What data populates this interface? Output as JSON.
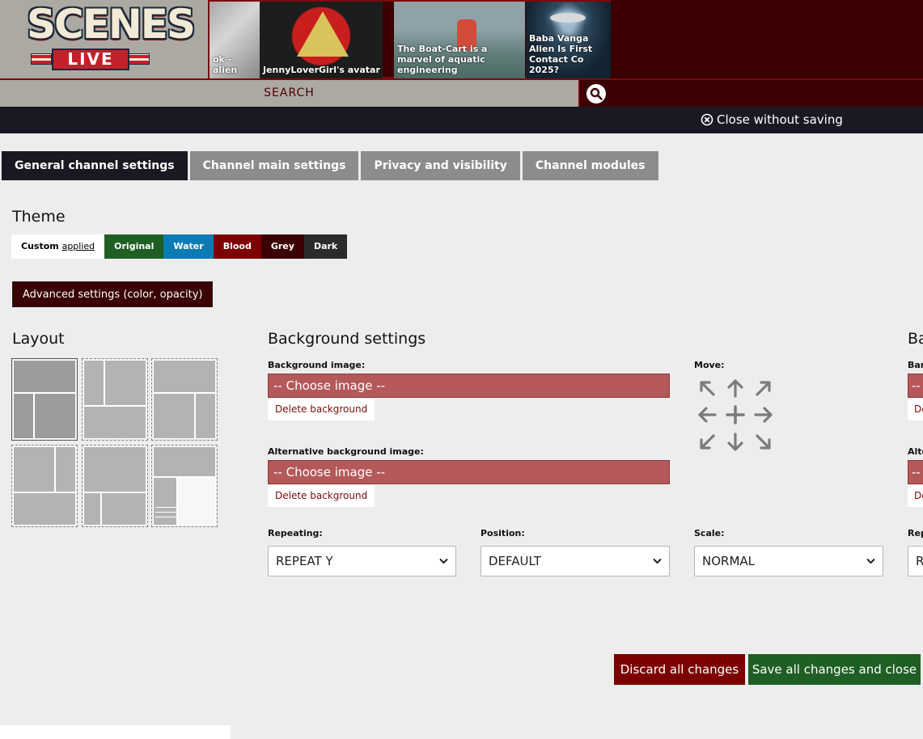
{
  "header": {
    "logo_line1": "SCENES",
    "logo_line2": "LIVE",
    "thumbnails": [
      {
        "caption": "ok - alien"
      },
      {
        "caption": "JennyLoverGirl's avatar"
      },
      {
        "caption": "The Boat-Cart is a marvel of aquatic engineering"
      },
      {
        "caption": "Baba Vanga Alien Is First Contact Co 2025?"
      }
    ],
    "search_placeholder": "SEARCH",
    "close_label": "Close without saving"
  },
  "tabs": [
    {
      "label": "General channel settings",
      "active": true
    },
    {
      "label": "Channel main settings",
      "active": false
    },
    {
      "label": "Privacy and visibility",
      "active": false
    },
    {
      "label": "Channel modules",
      "active": false
    }
  ],
  "theme": {
    "title": "Theme",
    "custom_label": "Custom",
    "custom_status": "applied",
    "options": [
      {
        "label": "Original",
        "color": "#1f5f24"
      },
      {
        "label": "Water",
        "color": "#0a7bb5"
      },
      {
        "label": "Blood",
        "color": "#7d0000"
      },
      {
        "label": "Grey",
        "color": "#3a0003"
      },
      {
        "label": "Dark",
        "color": "#2b2b2b"
      }
    ],
    "advanced_label": "Advanced settings (color, opacity)"
  },
  "layout": {
    "title": "Layout",
    "selected_index": 0
  },
  "background": {
    "title": "Background settings",
    "title_right_partial": "Ba",
    "image_label": "Background image:",
    "image_value": "-- Choose image --",
    "delete_label": "Delete background",
    "alt_image_label": "Alternative background image:",
    "alt_image_value": "-- Choose image --",
    "alt_delete_label": "Delete background",
    "move_label": "Move:",
    "repeating_label": "Repeating:",
    "repeating_value": "REPEAT Y",
    "position_label": "Position:",
    "position_value": "DEFAULT",
    "scale_label": "Scale:",
    "scale_value": "NORMAL",
    "right_col": {
      "image_label_partial": "Ban",
      "alt_label_partial": "Alte",
      "repeat_label_partial": "Rep",
      "select_partial": "R",
      "image_value_partial": "--",
      "delete_partial": "De"
    }
  },
  "footer": {
    "discard_label": "Discard all changes",
    "save_label": "Save all changes and close"
  }
}
